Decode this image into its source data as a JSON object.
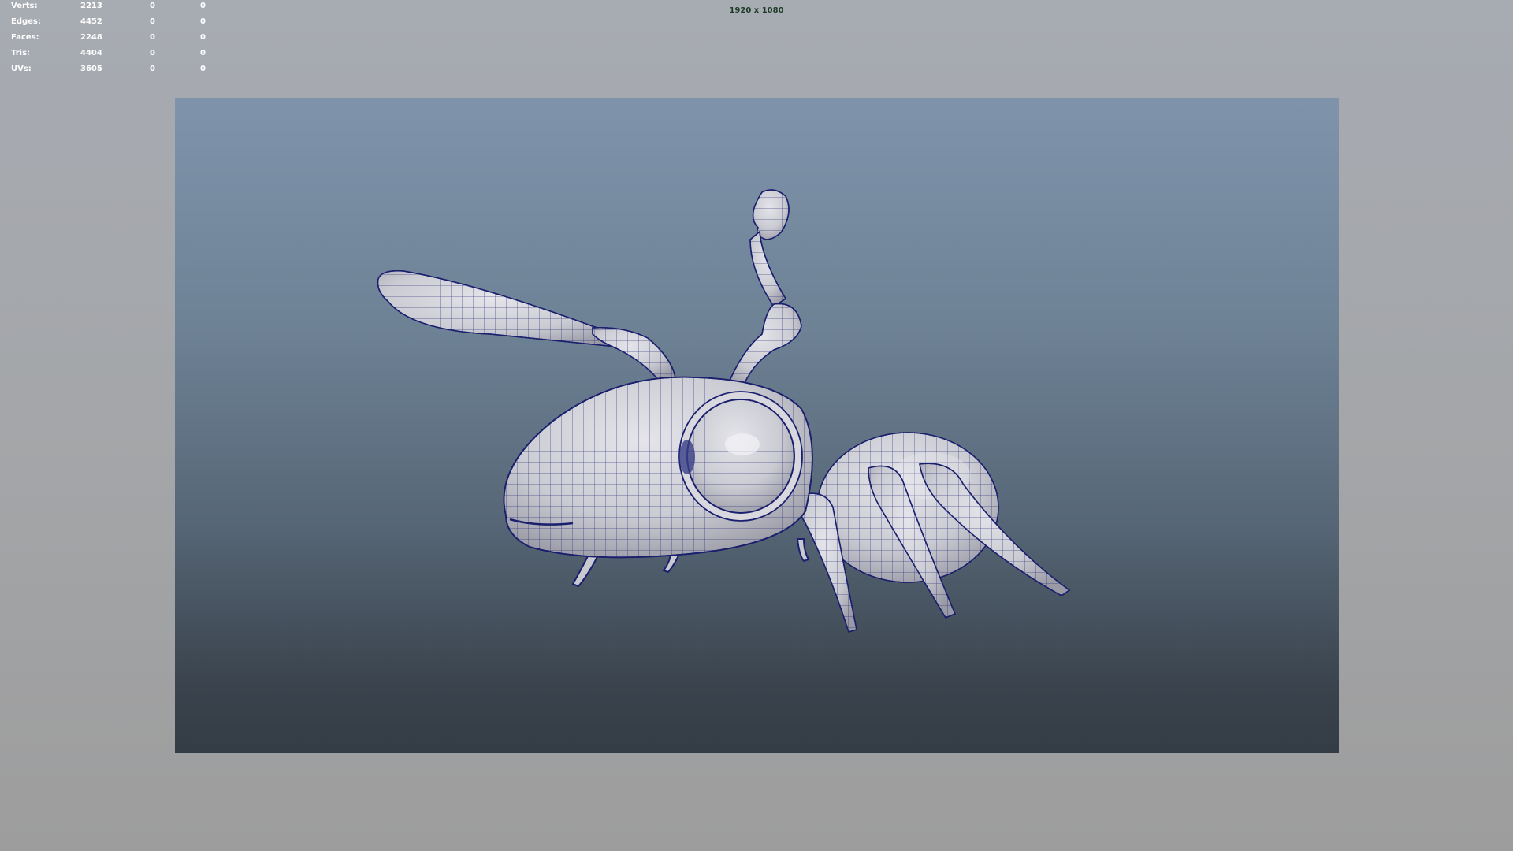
{
  "hud": {
    "stats": [
      {
        "label": "Verts:",
        "count": "2213",
        "sel1": "0",
        "sel2": "0"
      },
      {
        "label": "Edges:",
        "count": "4452",
        "sel1": "0",
        "sel2": "0"
      },
      {
        "label": "Faces:",
        "count": "2248",
        "sel1": "0",
        "sel2": "0"
      },
      {
        "label": "Tris:",
        "count": "4404",
        "sel1": "0",
        "sel2": "0"
      },
      {
        "label": "UVs:",
        "count": "3605",
        "sel1": "0",
        "sel2": "0"
      }
    ]
  },
  "viewport": {
    "resolution_label": "1920 x 1080"
  },
  "colors": {
    "wireframe": "#1a1f6e",
    "mesh": "#cfcfd6",
    "gate_top": "#7f94ab",
    "gate_bottom": "#343c45"
  }
}
